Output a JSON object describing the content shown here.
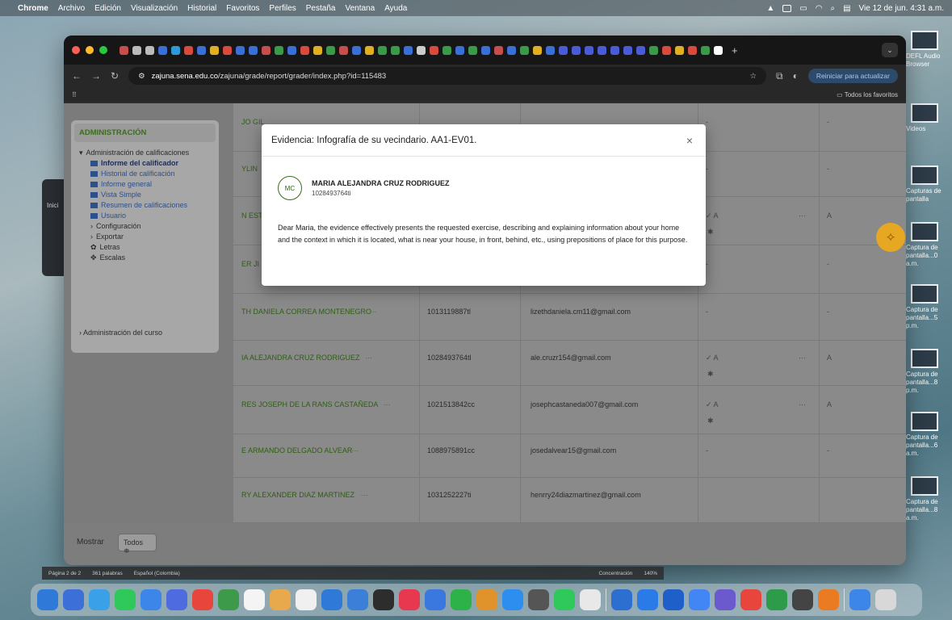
{
  "menubar": {
    "app": "Chrome",
    "items": [
      "Archivo",
      "Edición",
      "Visualización",
      "Historial",
      "Favoritos",
      "Perfiles",
      "Pestaña",
      "Ventana",
      "Ayuda"
    ],
    "datetime": "Vie 12 de jun. 4:31 a.m."
  },
  "browser": {
    "url_host": "zajuna.sena.edu.co",
    "url_path": "/zajuna/grade/report/grader/index.php?id=115483",
    "reload_button": "Reiniciar para actualizar",
    "bookmarks_all": "Todos los favoritos",
    "tab_colors": [
      "#c84d4d",
      "#bbb",
      "#bbb",
      "#3b6fd8",
      "#2e9ad8",
      "#d84a3b",
      "#3b6fd8",
      "#e0b020",
      "#d84a3b",
      "#3b6fd8",
      "#3b6fd8",
      "#c84d4d",
      "#3a9a4a",
      "#3b6fd8",
      "#d84a3b",
      "#e0b020",
      "#3a9a4a",
      "#c84d4d",
      "#3b6fd8",
      "#e0b020",
      "#3a9a4a",
      "#3a9a4a",
      "#3b6fd8",
      "#ccc",
      "#d84a3b",
      "#3a9a4a",
      "#3b6fd8",
      "#3a9a4a",
      "#3b6fd8",
      "#c84d4d",
      "#3b6fd8",
      "#3a9a4a",
      "#e0b020",
      "#3b6fd8",
      "#4a5bd8",
      "#4a5bd8",
      "#4a5bd8",
      "#4a5bd8",
      "#4a5bd8",
      "#4a5bd8",
      "#4a5bd8",
      "#3a9a4a",
      "#d84a3b",
      "#e0b020",
      "#d84a3b",
      "#3a9a4a",
      "#fff"
    ]
  },
  "admin": {
    "title": "ADMINISTRACIÓN",
    "section": "Administración de calificaciones",
    "items": [
      {
        "label": "Informe del calificador",
        "bold": true
      },
      {
        "label": "Historial de calificación"
      },
      {
        "label": "Informe general"
      },
      {
        "label": "Vista Simple"
      },
      {
        "label": "Resumen de calificaciones"
      },
      {
        "label": "Usuario"
      }
    ],
    "subsections": [
      "Configuración",
      "Exportar"
    ],
    "extras": [
      "Letras",
      "Escalas"
    ],
    "course": "Administración del curso"
  },
  "grades": {
    "rows": [
      {
        "name": "JO GIL",
        "id": "",
        "email": "",
        "m1": "-",
        "m2": "",
        "m3": "-"
      },
      {
        "name": "YLIN",
        "id": "",
        "email": "",
        "m1": "-",
        "m2": "",
        "m3": "-"
      },
      {
        "name": "N EST",
        "id": "",
        "email": "",
        "m1": "✓ A",
        "m2": "···",
        "m3": "A",
        "star": "✱"
      },
      {
        "name": "ER JI",
        "id": "",
        "email": "",
        "m1": "-",
        "m2": "",
        "m3": "-"
      },
      {
        "name": "TH DANIELA CORREA MONTENEGRO",
        "id": "1013119887tl",
        "email": "lizethdaniela.cm11@gmail.com",
        "m1": "-",
        "m2": "",
        "m3": "-"
      },
      {
        "name": "IA ALEJANDRA CRUZ RODRIGUEZ",
        "id": "1028493764tl",
        "email": "ale.cruzr154@gmail.com",
        "m1": "✓ A",
        "m2": "···",
        "m3": "A",
        "star": "✱"
      },
      {
        "name": "RES JOSEPH DE LA RANS CASTAÑEDA",
        "id": "1021513842cc",
        "email": "josephcastaneda007@gmail.com",
        "m1": "✓ A",
        "m2": "···",
        "m3": "A",
        "star": "✱"
      },
      {
        "name": "E ARMANDO DELGADO ALVEAR",
        "id": "1088975891cc",
        "email": "josedalvear15@gmail.com",
        "m1": "-",
        "m2": "",
        "m3": "-"
      },
      {
        "name": "RY ALEXANDER DIAZ MARTINEZ",
        "id": "1031252227ti",
        "email": "henrry24diazmartinez@gmail.com",
        "m1": "",
        "m2": "",
        "m3": ""
      }
    ]
  },
  "footer": {
    "show_label": "Mostrar",
    "show_value": "Todos ≑"
  },
  "modal": {
    "title": "Evidencia: Infografía de su vecindario. AA1-EV01.",
    "close": "×",
    "avatar": "MC",
    "user_name": "MARIA ALEJANDRA CRUZ RODRIGUEZ",
    "user_id": "1028493764ti",
    "feedback": "Dear Maria, the evidence effectively presents the requested exercise, describing and explaining information about your home and the context in which it is located, what is near your house, in front, behind, etc., using prepositions of place for this purpose."
  },
  "desktop": [
    {
      "label": "DEFL Audio Browser"
    },
    {
      "label": "Videos"
    },
    {
      "label": "Capturas de pantalla"
    },
    {
      "label": "Captura de pantalla...0 a.m."
    },
    {
      "label": "Captura de pantalla...5 p.m."
    },
    {
      "label": "Captura de pantalla...8 p.m."
    },
    {
      "label": "Captura de pantalla...6 a.m."
    },
    {
      "label": "Captura de pantalla...8 a.m."
    }
  ],
  "wordbar": {
    "page": "Página 2 de 2",
    "words": "361 palabras",
    "lang": "Español (Colombia)",
    "focus": "Concentración",
    "zoom": "140%"
  },
  "dock": {
    "colors": [
      "#2f7ad9",
      "#3c6fd8",
      "#3aa0e8",
      "#2ec95a",
      "#3b86e8",
      "#4f6be0",
      "#e8453c",
      "#3c9a4a",
      "#f4f4f4",
      "#e8a84c",
      "#f0f0f0",
      "#2f7ad9",
      "#3b7fd8",
      "#2d2d2d",
      "#e8384f",
      "#3a78e0",
      "#2db24a",
      "#e0932a",
      "#2d8ef0",
      "#555",
      "#2ec95a",
      "#e8e8e8",
      "#2d6fd0",
      "#2a7ae8",
      "#1e5fc9",
      "#4285f4",
      "#6a5acd",
      "#e8453c",
      "#2e9b4a",
      "#444",
      "#ea7b22",
      "#3b86e8",
      "#d8d8d8"
    ]
  }
}
